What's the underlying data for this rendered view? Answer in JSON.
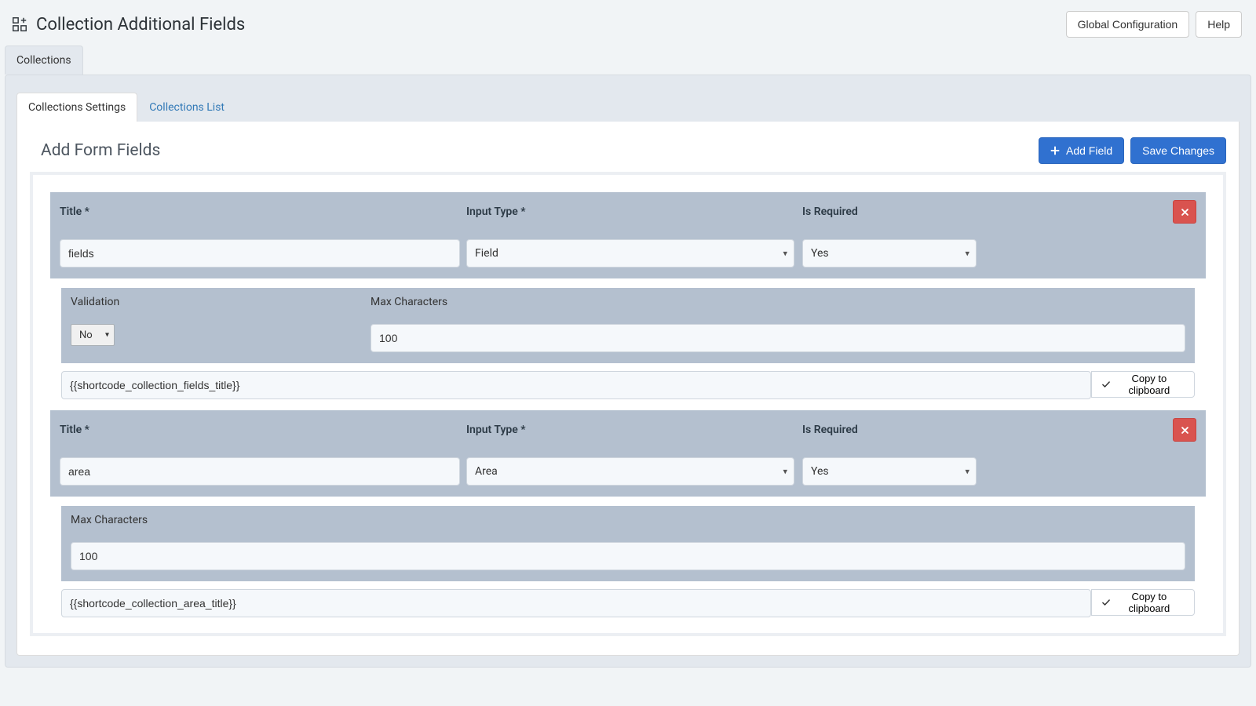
{
  "header": {
    "title": "Collection Additional Fields",
    "global_config_label": "Global Configuration",
    "help_label": "Help"
  },
  "primary_tab": "Collections",
  "inner_tabs": {
    "settings": "Collections Settings",
    "list": "Collections List"
  },
  "panel": {
    "title": "Add Form Fields",
    "add_field_label": "Add Field",
    "save_changes_label": "Save Changes"
  },
  "labels": {
    "title": "Title *",
    "input_type": "Input Type *",
    "is_required": "Is Required",
    "validation": "Validation",
    "max_chars": "Max Characters",
    "copy": "Copy to clipboard"
  },
  "fields": [
    {
      "title_value": "fields",
      "input_type": "Field",
      "is_required": "Yes",
      "has_validation": true,
      "validation_value": "No",
      "max_chars": "100",
      "shortcode": "{{shortcode_collection_fields_title}}"
    },
    {
      "title_value": "area",
      "input_type": "Area",
      "is_required": "Yes",
      "has_validation": false,
      "max_chars": "100",
      "shortcode": "{{shortcode_collection_area_title}}"
    }
  ]
}
